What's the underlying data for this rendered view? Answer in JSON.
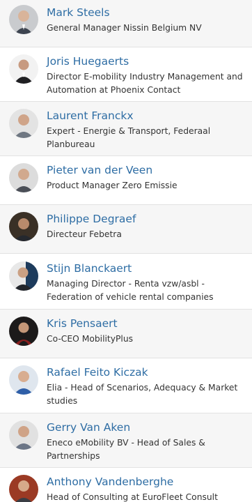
{
  "speakers": [
    {
      "name": "Mark Steels",
      "role": "General Manager Nissin Belgium NV"
    },
    {
      "name": "Joris Huegaerts",
      "role": "Director E-mobility Industry Management and Automation at Phoenix Contact"
    },
    {
      "name": "Laurent Franckx",
      "role": "Expert - Energie & Transport, Federaal Planbureau"
    },
    {
      "name": "Pieter van der Veen",
      "role": "Product Manager Zero Emissie"
    },
    {
      "name": "Philippe Degraef",
      "role": "Directeur Febetra"
    },
    {
      "name": "Stijn Blanckaert",
      "role": "Managing Director - Renta vzw/asbl - Federation of vehicle rental companies"
    },
    {
      "name": "Kris Pensaert",
      "role": "Co-CEO MobilityPlus"
    },
    {
      "name": "Rafael Feito Kiczak",
      "role": "Elia - Head of Scenarios, Adequacy & Market studies"
    },
    {
      "name": "Gerry Van Aken",
      "role": "Eneco eMobility BV - Head of Sales & Partnerships"
    },
    {
      "name": "Anthony Vandenberghe",
      "role": "Head of Consulting at EuroFleet Consult"
    }
  ],
  "colors": {
    "name_link": "#2e6da4",
    "role_text": "#333333",
    "row_alt_background": "#f6f6f6",
    "divider": "#e2e2e2"
  },
  "icons": {
    "avatar": "speaker-photo"
  }
}
